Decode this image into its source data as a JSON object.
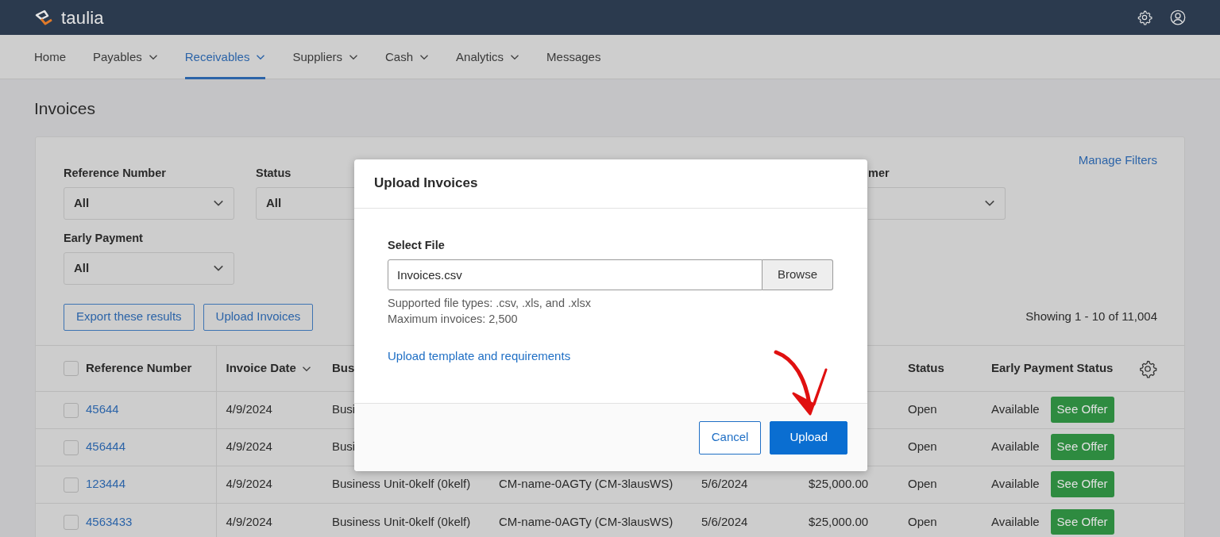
{
  "app": {
    "logo_text": "taulia"
  },
  "nav": [
    {
      "label": "Home",
      "dropdown": false,
      "selected": false
    },
    {
      "label": "Payables",
      "dropdown": true,
      "selected": false
    },
    {
      "label": "Receivables",
      "dropdown": true,
      "selected": true
    },
    {
      "label": "Suppliers",
      "dropdown": true,
      "selected": false
    },
    {
      "label": "Cash",
      "dropdown": true,
      "selected": false
    },
    {
      "label": "Analytics",
      "dropdown": true,
      "selected": false
    },
    {
      "label": "Messages",
      "dropdown": false,
      "selected": false
    }
  ],
  "page": {
    "title": "Invoices"
  },
  "filters": {
    "manage_link": "Manage Filters",
    "rows": [
      [
        {
          "label": "Reference Number",
          "value": "All"
        },
        {
          "label": "Status",
          "value": "All"
        },
        {
          "label": "mer"
        }
      ],
      [
        {
          "label": "Early Payment",
          "value": "All"
        }
      ]
    ],
    "actions": [
      "Export these results",
      "Upload Invoices"
    ],
    "results_count": "Showing 1 - 10 of 11,004"
  },
  "table": {
    "select_all": {
      "checked": false
    },
    "columns": [
      {
        "label": "Reference Number"
      },
      {
        "label": "Invoice Date",
        "sorted": true
      },
      {
        "label": "Bus"
      },
      {},
      {},
      {},
      {
        "label": "Status"
      },
      {
        "label": "Early Payment Status"
      }
    ],
    "rows": [
      {
        "checked": false,
        "cells": [
          "45644",
          "4/9/2024",
          "Busi",
          null,
          null,
          null,
          "Open",
          "Available"
        ],
        "action": "See Offer"
      },
      {
        "checked": false,
        "cells": [
          "456444",
          "4/9/2024",
          "Busi",
          null,
          null,
          null,
          "Open",
          "Available"
        ],
        "action": "See Offer"
      },
      {
        "checked": false,
        "cells": [
          "123444",
          "4/9/2024",
          "Business Unit-0kelf (0kelf)",
          "CM-name-0AGTy (CM-3lausWS)",
          "5/6/2024",
          "$25,000.00",
          "Open",
          "Available"
        ],
        "action": "See Offer"
      },
      {
        "checked": false,
        "cells": [
          "4563433",
          "4/9/2024",
          "Business Unit-0kelf (0kelf)",
          "CM-name-0AGTy (CM-3lausWS)",
          "5/6/2024",
          "$25,000.00",
          "Open",
          "Available"
        ],
        "action": "See Offer"
      }
    ]
  },
  "modal": {
    "title": "Upload Invoices",
    "field_label": "Select File",
    "file_value": "Invoices.csv",
    "browse": "Browse",
    "help": [
      "Supported file types: .csv, .xls, and .xlsx",
      "Maximum invoices: 2,500"
    ],
    "link": "Upload template and requirements",
    "buttons": [
      {
        "label": "Cancel",
        "kind": "secondary"
      },
      {
        "label": "Upload",
        "kind": "primary"
      }
    ]
  }
}
